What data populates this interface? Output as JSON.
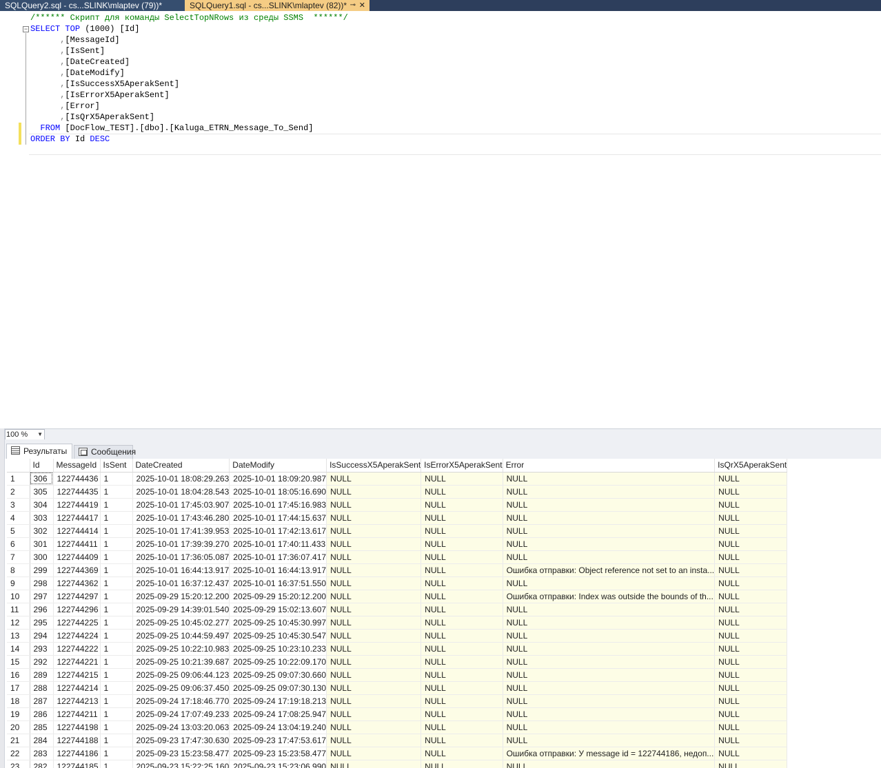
{
  "tabs": [
    {
      "label": "SQLQuery2.sql - cs...SLINK\\mlaptev (79))*",
      "active": false
    },
    {
      "label": "SQLQuery1.sql - cs...SLINK\\mlaptev (82))*",
      "active": true,
      "pin_glyph": "⊸",
      "close_glyph": "✕"
    }
  ],
  "editor": {
    "comment": "/****** Скрипт для команды SelectTopNRows из среды SSMS  ******/",
    "select_kw": "SELECT",
    "top_kw": "TOP",
    "top_value": "(1000)",
    "first_column": "[Id]",
    "columns": [
      "[MessageId]",
      "[IsSent]",
      "[DateCreated]",
      "[DateModify]",
      "[IsSuccessX5AperakSent]",
      "[IsErrorX5AperakSent]",
      "[Error]",
      "[IsQrX5AperakSent]"
    ],
    "from_kw": "FROM",
    "from_table": "[DocFlow_TEST].[dbo].[Kaluga_ETRN_Message_To_Send]",
    "order_kw": "ORDER BY",
    "order_col": "Id",
    "order_dir": "DESC"
  },
  "zoom": {
    "value": "100 %"
  },
  "results_tabs": {
    "results": "Результаты",
    "messages": "Сообщения"
  },
  "grid": {
    "columns": [
      "Id",
      "MessageId",
      "IsSent",
      "DateCreated",
      "DateModify",
      "IsSuccessX5AperakSent",
      "IsErrorX5AperakSent",
      "Error",
      "IsQrX5AperakSent"
    ],
    "rows": [
      [
        "1",
        "306",
        "122744436",
        "1",
        "2025-10-01 18:08:29.263",
        "2025-10-01 18:09:20.987",
        "NULL",
        "NULL",
        "NULL",
        "NULL"
      ],
      [
        "2",
        "305",
        "122744435",
        "1",
        "2025-10-01 18:04:28.543",
        "2025-10-01 18:05:16.690",
        "NULL",
        "NULL",
        "NULL",
        "NULL"
      ],
      [
        "3",
        "304",
        "122744419",
        "1",
        "2025-10-01 17:45:03.907",
        "2025-10-01 17:45:16.983",
        "NULL",
        "NULL",
        "NULL",
        "NULL"
      ],
      [
        "4",
        "303",
        "122744417",
        "1",
        "2025-10-01 17:43:46.280",
        "2025-10-01 17:44:15.637",
        "NULL",
        "NULL",
        "NULL",
        "NULL"
      ],
      [
        "5",
        "302",
        "122744414",
        "1",
        "2025-10-01 17:41:39.953",
        "2025-10-01 17:42:13.617",
        "NULL",
        "NULL",
        "NULL",
        "NULL"
      ],
      [
        "6",
        "301",
        "122744411",
        "1",
        "2025-10-01 17:39:39.270",
        "2025-10-01 17:40:11.433",
        "NULL",
        "NULL",
        "NULL",
        "NULL"
      ],
      [
        "7",
        "300",
        "122744409",
        "1",
        "2025-10-01 17:36:05.087",
        "2025-10-01 17:36:07.417",
        "NULL",
        "NULL",
        "NULL",
        "NULL"
      ],
      [
        "8",
        "299",
        "122744369",
        "1",
        "2025-10-01 16:44:13.917",
        "2025-10-01 16:44:13.917",
        "NULL",
        "NULL",
        "Ошибка отправки: Object reference not set to an insta...",
        "NULL"
      ],
      [
        "9",
        "298",
        "122744362",
        "1",
        "2025-10-01 16:37:12.437",
        "2025-10-01 16:37:51.550",
        "NULL",
        "NULL",
        "NULL",
        "NULL"
      ],
      [
        "10",
        "297",
        "122744297",
        "1",
        "2025-09-29 15:20:12.200",
        "2025-09-29 15:20:12.200",
        "NULL",
        "NULL",
        "Ошибка отправки: Index was outside the bounds of th...",
        "NULL"
      ],
      [
        "11",
        "296",
        "122744296",
        "1",
        "2025-09-29 14:39:01.540",
        "2025-09-29 15:02:13.607",
        "NULL",
        "NULL",
        "NULL",
        "NULL"
      ],
      [
        "12",
        "295",
        "122744225",
        "1",
        "2025-09-25 10:45:02.277",
        "2025-09-25 10:45:30.997",
        "NULL",
        "NULL",
        "NULL",
        "NULL"
      ],
      [
        "13",
        "294",
        "122744224",
        "1",
        "2025-09-25 10:44:59.497",
        "2025-09-25 10:45:30.547",
        "NULL",
        "NULL",
        "NULL",
        "NULL"
      ],
      [
        "14",
        "293",
        "122744222",
        "1",
        "2025-09-25 10:22:10.983",
        "2025-09-25 10:23:10.233",
        "NULL",
        "NULL",
        "NULL",
        "NULL"
      ],
      [
        "15",
        "292",
        "122744221",
        "1",
        "2025-09-25 10:21:39.687",
        "2025-09-25 10:22:09.170",
        "NULL",
        "NULL",
        "NULL",
        "NULL"
      ],
      [
        "16",
        "289",
        "122744215",
        "1",
        "2025-09-25 09:06:44.123",
        "2025-09-25 09:07:30.660",
        "NULL",
        "NULL",
        "NULL",
        "NULL"
      ],
      [
        "17",
        "288",
        "122744214",
        "1",
        "2025-09-25 09:06:37.450",
        "2025-09-25 09:07:30.130",
        "NULL",
        "NULL",
        "NULL",
        "NULL"
      ],
      [
        "18",
        "287",
        "122744213",
        "1",
        "2025-09-24 17:18:46.770",
        "2025-09-24 17:19:18.213",
        "NULL",
        "NULL",
        "NULL",
        "NULL"
      ],
      [
        "19",
        "286",
        "122744211",
        "1",
        "2025-09-24 17:07:49.233",
        "2025-09-24 17:08:25.947",
        "NULL",
        "NULL",
        "NULL",
        "NULL"
      ],
      [
        "20",
        "285",
        "122744198",
        "1",
        "2025-09-24 13:03:20.063",
        "2025-09-24 13:04:19.240",
        "NULL",
        "NULL",
        "NULL",
        "NULL"
      ],
      [
        "21",
        "284",
        "122744188",
        "1",
        "2025-09-23 17:47:30.630",
        "2025-09-23 17:47:53.617",
        "NULL",
        "NULL",
        "NULL",
        "NULL"
      ],
      [
        "22",
        "283",
        "122744186",
        "1",
        "2025-09-23 15:23:58.477",
        "2025-09-23 15:23:58.477",
        "NULL",
        "NULL",
        "Ошибка отправки: У message id = 122744186, недоп...",
        "NULL"
      ],
      [
        "23",
        "282",
        "122744185",
        "1",
        "2025-09-23 15:22:25.160",
        "2025-09-23 15:23:06.990",
        "NULL",
        "NULL",
        "NULL",
        "NULL"
      ]
    ]
  }
}
